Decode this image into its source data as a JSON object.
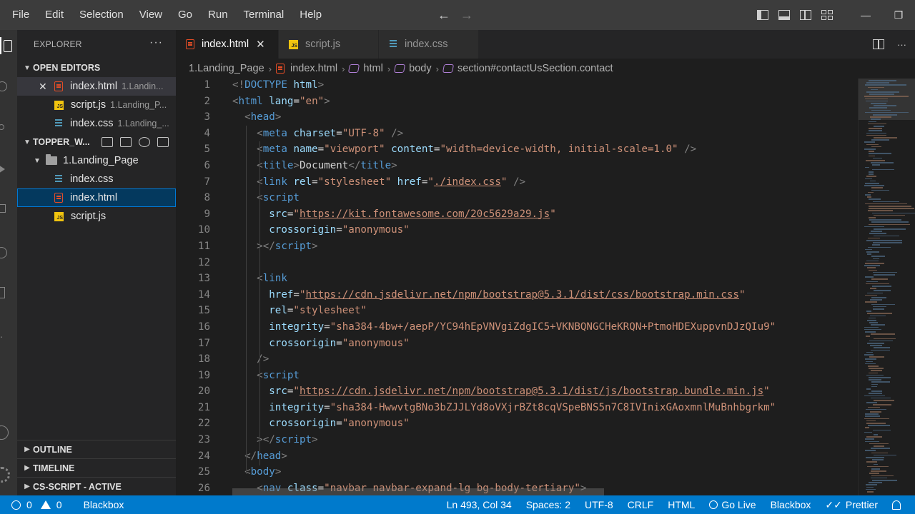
{
  "menu": [
    "File",
    "Edit",
    "Selection",
    "View",
    "Go",
    "Run",
    "Terminal",
    "Help"
  ],
  "nav": {
    "back": "←",
    "forward": "→"
  },
  "window": {
    "minimize": "—",
    "restore": "❐"
  },
  "sidebar": {
    "title": "EXPLORER",
    "more": "···",
    "open_editors_label": "OPEN EDITORS",
    "open_editors": [
      {
        "name": "index.html",
        "path": "1.Landin...",
        "type": "html"
      },
      {
        "name": "script.js",
        "path": "1.Landing_P...",
        "type": "js"
      },
      {
        "name": "index.css",
        "path": "1.Landing_...",
        "type": "css"
      }
    ],
    "workspace_label": "TOPPER_W...",
    "folder": "1.Landing_Page",
    "files": [
      {
        "name": "index.css",
        "type": "css"
      },
      {
        "name": "index.html",
        "type": "html"
      },
      {
        "name": "script.js",
        "type": "js"
      }
    ],
    "outline": "OUTLINE",
    "timeline": "TIMELINE",
    "cs_script": "CS-SCRIPT - ACTIVE"
  },
  "tabs": [
    {
      "label": "index.html",
      "type": "html",
      "active": true,
      "close": "✕"
    },
    {
      "label": "script.js",
      "type": "js"
    },
    {
      "label": "index.css",
      "type": "css"
    }
  ],
  "breadcrumb": {
    "folder": "1.Landing_Page",
    "file": "index.html",
    "html": "html",
    "body": "body",
    "section": "section#contactUsSection.contact"
  },
  "editor": {
    "line_numbers": [
      "1",
      "2",
      "3",
      "4",
      "5",
      "6",
      "7",
      "8",
      "9",
      "10",
      "11",
      "12",
      "13",
      "14",
      "15",
      "16",
      "17",
      "18",
      "19",
      "20",
      "21",
      "22",
      "23",
      "24",
      "25",
      "26"
    ],
    "lines": [
      [
        [
          "br",
          "<!"
        ],
        [
          "tag",
          "DOCTYPE"
        ],
        [
          "txt",
          " "
        ],
        [
          "attr",
          "html"
        ],
        [
          "br",
          ">"
        ]
      ],
      [
        [
          "br",
          "<"
        ],
        [
          "tag",
          "html"
        ],
        [
          "txt",
          " "
        ],
        [
          "attr",
          "lang"
        ],
        [
          "txt",
          "="
        ],
        [
          "str",
          "\"en\""
        ],
        [
          "br",
          ">"
        ]
      ],
      [
        [
          "txt",
          "  "
        ],
        [
          "br",
          "<"
        ],
        [
          "tag",
          "head"
        ],
        [
          "br",
          ">"
        ]
      ],
      [
        [
          "txt",
          "    "
        ],
        [
          "br",
          "<"
        ],
        [
          "tag",
          "meta"
        ],
        [
          "txt",
          " "
        ],
        [
          "attr",
          "charset"
        ],
        [
          "txt",
          "="
        ],
        [
          "str",
          "\"UTF-8\""
        ],
        [
          "txt",
          " "
        ],
        [
          "br",
          "/>"
        ]
      ],
      [
        [
          "txt",
          "    "
        ],
        [
          "br",
          "<"
        ],
        [
          "tag",
          "meta"
        ],
        [
          "txt",
          " "
        ],
        [
          "attr",
          "name"
        ],
        [
          "txt",
          "="
        ],
        [
          "str",
          "\"viewport\""
        ],
        [
          "txt",
          " "
        ],
        [
          "attr",
          "content"
        ],
        [
          "txt",
          "="
        ],
        [
          "str",
          "\"width=device-width, initial-scale=1.0\""
        ],
        [
          "txt",
          " "
        ],
        [
          "br",
          "/>"
        ]
      ],
      [
        [
          "txt",
          "    "
        ],
        [
          "br",
          "<"
        ],
        [
          "tag",
          "title"
        ],
        [
          "br",
          ">"
        ],
        [
          "txt",
          "Document"
        ],
        [
          "br",
          "</"
        ],
        [
          "tag",
          "title"
        ],
        [
          "br",
          ">"
        ]
      ],
      [
        [
          "txt",
          "    "
        ],
        [
          "br",
          "<"
        ],
        [
          "tag",
          "link"
        ],
        [
          "txt",
          " "
        ],
        [
          "attr",
          "rel"
        ],
        [
          "txt",
          "="
        ],
        [
          "str",
          "\"stylesheet\""
        ],
        [
          "txt",
          " "
        ],
        [
          "attr",
          "href"
        ],
        [
          "txt",
          "="
        ],
        [
          "str",
          "\""
        ],
        [
          "url",
          "./index.css"
        ],
        [
          "str",
          "\""
        ],
        [
          "txt",
          " "
        ],
        [
          "br",
          "/>"
        ]
      ],
      [
        [
          "txt",
          "    "
        ],
        [
          "br",
          "<"
        ],
        [
          "tag",
          "script"
        ]
      ],
      [
        [
          "txt",
          "      "
        ],
        [
          "attr",
          "src"
        ],
        [
          "txt",
          "="
        ],
        [
          "str",
          "\""
        ],
        [
          "url",
          "https://kit.fontawesome.com/20c5629a29.js"
        ],
        [
          "str",
          "\""
        ]
      ],
      [
        [
          "txt",
          "      "
        ],
        [
          "attr",
          "crossorigin"
        ],
        [
          "txt",
          "="
        ],
        [
          "str",
          "\"anonymous\""
        ]
      ],
      [
        [
          "txt",
          "    "
        ],
        [
          "br",
          "></"
        ],
        [
          "tag",
          "script"
        ],
        [
          "br",
          ">"
        ]
      ],
      [],
      [
        [
          "txt",
          "    "
        ],
        [
          "br",
          "<"
        ],
        [
          "tag",
          "link"
        ]
      ],
      [
        [
          "txt",
          "      "
        ],
        [
          "attr",
          "href"
        ],
        [
          "txt",
          "="
        ],
        [
          "str",
          "\""
        ],
        [
          "url",
          "https://cdn.jsdelivr.net/npm/bootstrap@5.3.1/dist/css/bootstrap.min.css"
        ],
        [
          "str",
          "\""
        ]
      ],
      [
        [
          "txt",
          "      "
        ],
        [
          "attr",
          "rel"
        ],
        [
          "txt",
          "="
        ],
        [
          "str",
          "\"stylesheet\""
        ]
      ],
      [
        [
          "txt",
          "      "
        ],
        [
          "attr",
          "integrity"
        ],
        [
          "txt",
          "="
        ],
        [
          "str",
          "\"sha384-4bw+/aepP/YC94hEpVNVgiZdgIC5+VKNBQNGCHeKRQN+PtmoHDEXuppvnDJzQIu9\""
        ]
      ],
      [
        [
          "txt",
          "      "
        ],
        [
          "attr",
          "crossorigin"
        ],
        [
          "txt",
          "="
        ],
        [
          "str",
          "\"anonymous\""
        ]
      ],
      [
        [
          "txt",
          "    "
        ],
        [
          "br",
          "/>"
        ]
      ],
      [
        [
          "txt",
          "    "
        ],
        [
          "br",
          "<"
        ],
        [
          "tag",
          "script"
        ]
      ],
      [
        [
          "txt",
          "      "
        ],
        [
          "attr",
          "src"
        ],
        [
          "txt",
          "="
        ],
        [
          "str",
          "\""
        ],
        [
          "url",
          "https://cdn.jsdelivr.net/npm/bootstrap@5.3.1/dist/js/bootstrap.bundle.min.js"
        ],
        [
          "str",
          "\""
        ]
      ],
      [
        [
          "txt",
          "      "
        ],
        [
          "attr",
          "integrity"
        ],
        [
          "txt",
          "="
        ],
        [
          "str",
          "\"sha384-HwwvtgBNo3bZJJLYd8oVXjrBZt8cqVSpeBNS5n7C8IVInixGAoxmnlMuBnhbgrkm\""
        ]
      ],
      [
        [
          "txt",
          "      "
        ],
        [
          "attr",
          "crossorigin"
        ],
        [
          "txt",
          "="
        ],
        [
          "str",
          "\"anonymous\""
        ]
      ],
      [
        [
          "txt",
          "    "
        ],
        [
          "br",
          "></"
        ],
        [
          "tag",
          "script"
        ],
        [
          "br",
          ">"
        ]
      ],
      [
        [
          "txt",
          "  "
        ],
        [
          "br",
          "</"
        ],
        [
          "tag",
          "head"
        ],
        [
          "br",
          ">"
        ]
      ],
      [
        [
          "txt",
          "  "
        ],
        [
          "br",
          "<"
        ],
        [
          "tag",
          "body"
        ],
        [
          "br",
          ">"
        ]
      ],
      [
        [
          "txt",
          "    "
        ],
        [
          "br",
          "<"
        ],
        [
          "tag",
          "nav"
        ],
        [
          "txt",
          " "
        ],
        [
          "attr",
          "class"
        ],
        [
          "txt",
          "="
        ],
        [
          "str",
          "\"navbar navbar-expand-lg bg-body-tertiary\""
        ],
        [
          "br",
          ">"
        ]
      ]
    ]
  },
  "status": {
    "errors": "0",
    "warnings": "0",
    "left_extension": "Blackbox",
    "position": "Ln 493, Col 34",
    "spaces": "Spaces: 2",
    "encoding": "UTF-8",
    "eol": "CRLF",
    "language": "HTML",
    "golive": "Go Live",
    "blackbox": "Blackbox",
    "prettier": "Prettier",
    "check": "✓✓"
  },
  "colors": {
    "statusbar": "#007acc",
    "tag": "#569cd6",
    "attr": "#9cdcfe",
    "string": "#ce9178"
  }
}
